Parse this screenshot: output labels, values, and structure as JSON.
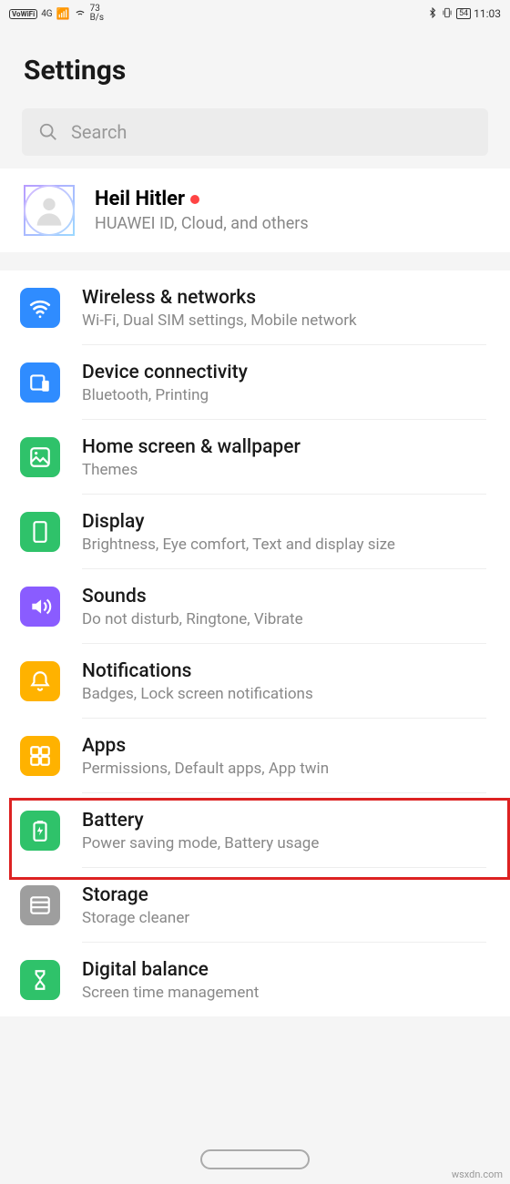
{
  "status": {
    "vowifi": "VoWiFi",
    "network": "4G",
    "speed_num": "73",
    "speed_unit": "B/s",
    "battery": "54",
    "time": "11:03"
  },
  "header": {
    "title": "Settings"
  },
  "search": {
    "placeholder": "Search"
  },
  "account": {
    "name": "Heil Hitler",
    "subtitle": "HUAWEI ID, Cloud, and others"
  },
  "items": [
    {
      "icon": "wifi",
      "color": "#2f8cff",
      "title": "Wireless & networks",
      "subtitle": "Wi-Fi, Dual SIM settings, Mobile network"
    },
    {
      "icon": "devices",
      "color": "#2f8cff",
      "title": "Device connectivity",
      "subtitle": "Bluetooth, Printing"
    },
    {
      "icon": "wallpaper",
      "color": "#2fc26a",
      "title": "Home screen & wallpaper",
      "subtitle": "Themes"
    },
    {
      "icon": "display",
      "color": "#2fc26a",
      "title": "Display",
      "subtitle": "Brightness, Eye comfort, Text and display size"
    },
    {
      "icon": "sound",
      "color": "#8a5cff",
      "title": "Sounds",
      "subtitle": "Do not disturb, Ringtone, Vibrate"
    },
    {
      "icon": "bell",
      "color": "#ffb200",
      "title": "Notifications",
      "subtitle": "Badges, Lock screen notifications"
    },
    {
      "icon": "apps",
      "color": "#ffb200",
      "title": "Apps",
      "subtitle": "Permissions, Default apps, App twin"
    },
    {
      "icon": "battery",
      "color": "#2fc26a",
      "title": "Battery",
      "subtitle": "Power saving mode, Battery usage"
    },
    {
      "icon": "storage",
      "color": "#9e9e9e",
      "title": "Storage",
      "subtitle": "Storage cleaner"
    },
    {
      "icon": "hourglass",
      "color": "#2fc26a",
      "title": "Digital balance",
      "subtitle": "Screen time management"
    }
  ],
  "watermark": "wsxdn.com"
}
